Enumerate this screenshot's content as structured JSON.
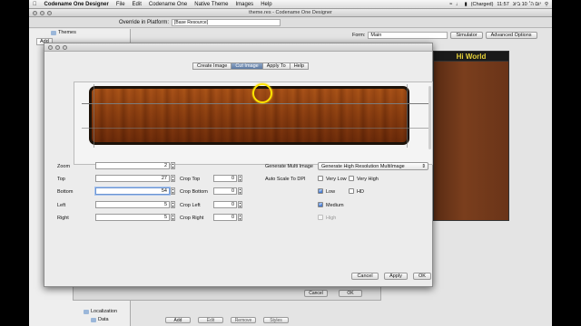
{
  "menubar": {
    "app": "Codename One Designer",
    "items": [
      "File",
      "Edit",
      "Codename One",
      "Native Theme",
      "Images",
      "Help"
    ],
    "status": "(Charged)",
    "clock": "11:57",
    "date": "יום ה׳ 10 ביונ"
  },
  "window": {
    "title": "theme.res - Codename One Designer",
    "override_label": "Override in Platform:",
    "override_value": "[Base Resource]",
    "themes_label": "Themes",
    "add_label": "Add",
    "localization_label": "Localization",
    "data_label": "Data"
  },
  "right": {
    "form_label": "Form:",
    "form_value": "Main",
    "simulator": "Simulator",
    "advanced": "Advanced Options",
    "preview_title": "Hi World"
  },
  "bottom_buttons": [
    "Add",
    "Edit",
    "Remove",
    "Styles"
  ],
  "behind_dialog": {
    "cancel": "Cancel",
    "ok": "OK"
  },
  "dialog": {
    "tabs": [
      "Create Image",
      "Cut Image",
      "Apply To",
      "Help"
    ],
    "active_tab": "Cut Image",
    "fields": {
      "zoom": {
        "label": "Zoom",
        "value": "2"
      },
      "top": {
        "label": "Top",
        "value": "27"
      },
      "bottom": {
        "label": "Bottom",
        "value": "54"
      },
      "left": {
        "label": "Left",
        "value": "5"
      },
      "right": {
        "label": "Right",
        "value": "5"
      },
      "crop_top": {
        "label": "Crop Top",
        "value": "0"
      },
      "crop_bottom": {
        "label": "Crop Bottom",
        "value": "0"
      },
      "crop_left": {
        "label": "Crop Left",
        "value": "0"
      },
      "crop_right": {
        "label": "Crop Right",
        "value": "0"
      }
    },
    "multi_label": "Generate Multi Image",
    "multi_value": "Generate High Resolution MultiImage",
    "auto_scale_label": "Auto Scale To DPI",
    "dpi": {
      "very_low": {
        "label": "Very Low",
        "checked": false
      },
      "very_high": {
        "label": "Very High",
        "checked": false
      },
      "low": {
        "label": "Low",
        "checked": true
      },
      "hd": {
        "label": "HD",
        "checked": false
      },
      "medium": {
        "label": "Medium",
        "checked": true
      },
      "high": {
        "label": "High",
        "checked": false
      }
    },
    "buttons": {
      "cancel": "Cancel",
      "apply": "Apply",
      "ok": "OK"
    }
  }
}
